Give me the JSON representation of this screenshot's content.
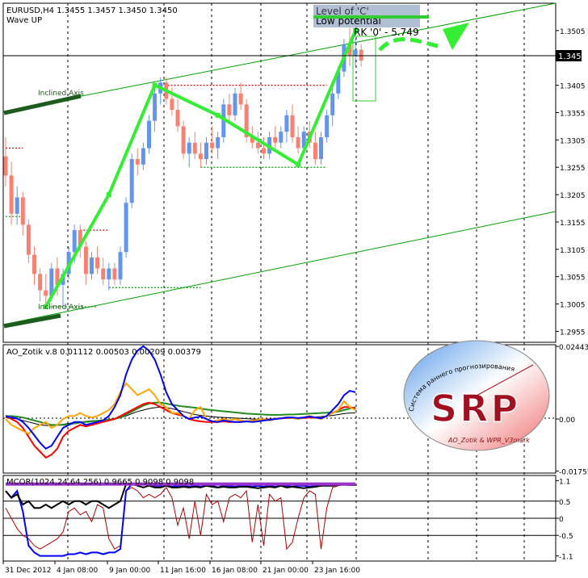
{
  "header": {
    "symbol_line": "EURUSD,H4  1.3455 1.3457 1.3450 1.3450",
    "wave_label": "Wave UP"
  },
  "annotations": {
    "level_c": "Level of 'C'",
    "low_potential": "Low potential",
    "rk_label": "RK '0' - ",
    "rk_value": "5.749",
    "inclined_axis_top": "Inclined Axis",
    "inclined_axis_bottom": "Inclined Axis"
  },
  "colors": {
    "bull": "#6495ED",
    "bear": "#FA8072",
    "wave": "#33EE33",
    "channel": "#00A000",
    "axis_bold": "#1E5B1E",
    "level_box": "#A8B8D0",
    "blue_line": "#0000FF",
    "orange_line": "#FFA500",
    "green_line": "#228B22",
    "red_line": "#FF0000",
    "black_line": "#000000",
    "purple_line": "#9933CC"
  },
  "price_panel": {
    "current_price": "1.3450",
    "ticks": [
      "1.3505",
      "1.3405",
      "1.3355",
      "1.3305",
      "1.3255",
      "1.3205",
      "1.3155",
      "1.3105",
      "1.3055",
      "1.3005",
      "1.2955"
    ]
  },
  "ao_panel": {
    "title": "AO_Zotik v.8 0.01112 0.00503 0.00209 0.00379",
    "ticks": [
      "0.02443",
      "0.00",
      "-0.01755"
    ]
  },
  "mcor_panel": {
    "title": "MCOR(1024,24,64,256) 0.9665 0.9098 0.9098",
    "ticks": [
      "1.1",
      "0.5",
      "0",
      "-0.5",
      "-1.1"
    ]
  },
  "time_axis": {
    "labels": [
      "31 Dec 2012",
      "4 Jan 08:00",
      "9 Jan 00:00",
      "11 Jan 16:00",
      "16 Jan 08:00",
      "21 Jan 00:00",
      "23 Jan 16:00"
    ]
  },
  "logo": {
    "letters": "SRP",
    "arc_text": "Система раннего прогнозирования",
    "caption": "AO_Zotik & WPR_V3mark"
  },
  "chart_data": [
    {
      "type": "candlestick",
      "symbol": "EURUSD",
      "timeframe": "H4",
      "ylim": [
        1.2935,
        1.3555
      ],
      "candles": [
        [
          1.3275,
          1.331,
          1.322,
          1.324
        ],
        [
          1.324,
          1.3265,
          1.315,
          1.317
        ],
        [
          1.317,
          1.322,
          1.315,
          1.32
        ],
        [
          1.32,
          1.321,
          1.313,
          1.315
        ],
        [
          1.315,
          1.316,
          1.308,
          1.3095
        ],
        [
          1.3095,
          1.311,
          1.304,
          1.306
        ],
        [
          1.306,
          1.307,
          1.301,
          1.303
        ],
        [
          1.303,
          1.306,
          1.3,
          1.302
        ],
        [
          1.302,
          1.308,
          1.301,
          1.307
        ],
        [
          1.307,
          1.309,
          1.302,
          1.304
        ],
        [
          1.304,
          1.307,
          1.3,
          1.306
        ],
        [
          1.306,
          1.311,
          1.305,
          1.31
        ],
        [
          1.31,
          1.315,
          1.308,
          1.314
        ],
        [
          1.314,
          1.315,
          1.309,
          1.311
        ],
        [
          1.311,
          1.312,
          1.304,
          1.306
        ],
        [
          1.306,
          1.31,
          1.305,
          1.309
        ],
        [
          1.309,
          1.311,
          1.306,
          1.307
        ],
        [
          1.307,
          1.309,
          1.304,
          1.305
        ],
        [
          1.305,
          1.308,
          1.303,
          1.307
        ],
        [
          1.307,
          1.308,
          1.304,
          1.305
        ],
        [
          1.305,
          1.311,
          1.304,
          1.31
        ],
        [
          1.31,
          1.32,
          1.309,
          1.319
        ],
        [
          1.319,
          1.328,
          1.318,
          1.327
        ],
        [
          1.327,
          1.329,
          1.324,
          1.326
        ],
        [
          1.326,
          1.33,
          1.325,
          1.329
        ],
        [
          1.329,
          1.335,
          1.328,
          1.334
        ],
        [
          1.334,
          1.34,
          1.332,
          1.339
        ],
        [
          1.339,
          1.342,
          1.337,
          1.341
        ],
        [
          1.341,
          1.342,
          1.337,
          1.338
        ],
        [
          1.338,
          1.34,
          1.335,
          1.336
        ],
        [
          1.336,
          1.338,
          1.332,
          1.333
        ],
        [
          1.333,
          1.334,
          1.327,
          1.328
        ],
        [
          1.328,
          1.331,
          1.3255,
          1.33
        ],
        [
          1.33,
          1.332,
          1.327,
          1.328
        ],
        [
          1.328,
          1.33,
          1.3255,
          1.327
        ],
        [
          1.327,
          1.331,
          1.326,
          1.33
        ],
        [
          1.33,
          1.333,
          1.328,
          1.329
        ],
        [
          1.329,
          1.332,
          1.327,
          1.331
        ],
        [
          1.331,
          1.338,
          1.33,
          1.337
        ],
        [
          1.337,
          1.339,
          1.334,
          1.335
        ],
        [
          1.335,
          1.34,
          1.334,
          1.339
        ],
        [
          1.339,
          1.341,
          1.336,
          1.337
        ],
        [
          1.337,
          1.338,
          1.33,
          1.331
        ],
        [
          1.331,
          1.333,
          1.329,
          1.33
        ],
        [
          1.33,
          1.332,
          1.328,
          1.329
        ],
        [
          1.329,
          1.331,
          1.327,
          1.328
        ],
        [
          1.328,
          1.332,
          1.327,
          1.331
        ],
        [
          1.331,
          1.333,
          1.329,
          1.33
        ],
        [
          1.33,
          1.333,
          1.329,
          1.332
        ],
        [
          1.332,
          1.336,
          1.33,
          1.335
        ],
        [
          1.335,
          1.337,
          1.33,
          1.331
        ],
        [
          1.331,
          1.333,
          1.328,
          1.329
        ],
        [
          1.329,
          1.333,
          1.328,
          1.332
        ],
        [
          1.332,
          1.334,
          1.329,
          1.33
        ],
        [
          1.33,
          1.332,
          1.326,
          1.327
        ],
        [
          1.327,
          1.332,
          1.326,
          1.331
        ],
        [
          1.331,
          1.336,
          1.33,
          1.335
        ],
        [
          1.335,
          1.34,
          1.333,
          1.339
        ],
        [
          1.339,
          1.344,
          1.338,
          1.343
        ],
        [
          1.343,
          1.349,
          1.342,
          1.348
        ],
        [
          1.348,
          1.351,
          1.344,
          1.346
        ],
        [
          1.346,
          1.349,
          1.344,
          1.347
        ],
        [
          1.347,
          1.348,
          1.344,
          1.345
        ]
      ],
      "wave_path": [
        [
          7,
          1.3
        ],
        [
          18,
          1.3205
        ],
        [
          26,
          1.3405
        ],
        [
          37,
          1.335
        ],
        [
          51,
          1.326
        ],
        [
          61,
          1.3505
        ]
      ],
      "support_resistance": [
        {
          "price": 1.3405,
          "color": "red",
          "from": 26,
          "to": 56
        },
        {
          "price": 1.3255,
          "color": "green",
          "from": 34,
          "to": 56
        },
        {
          "price": 1.329,
          "color": "red",
          "from": 0,
          "to": 3
        },
        {
          "price": 1.314,
          "color": "red",
          "from": 13,
          "to": 18
        },
        {
          "price": 1.3165,
          "color": "green",
          "from": 0,
          "to": 3
        },
        {
          "price": 1.3035,
          "color": "green",
          "from": 18,
          "to": 34
        },
        {
          "price": 1.3,
          "color": "green",
          "from": 7,
          "to": 16
        }
      ]
    },
    {
      "type": "line",
      "name": "AO_Zotik v.8",
      "ylim": [
        -0.0182,
        0.025
      ],
      "series": [
        {
          "name": "blue",
          "values": [
            0.001,
            0.0005,
            0.0002,
            -0.001,
            -0.003,
            -0.0055,
            -0.008,
            -0.01,
            -0.009,
            -0.006,
            -0.003,
            -0.002,
            -0.001,
            -0.001,
            -0.002,
            -0.0015,
            -0.001,
            -0.0005,
            0.001,
            0.004,
            0.008,
            0.015,
            0.02,
            0.023,
            0.0245,
            0.023,
            0.02,
            0.015,
            0.009,
            0.005,
            0.003,
            0.001,
            0.0,
            0.0005,
            0.0008,
            0.0,
            -0.0008,
            -0.001,
            -0.0005,
            -0.0008,
            -0.001,
            -0.001,
            -0.0008,
            -0.001,
            -0.0008,
            -0.0005,
            -0.0003,
            0.0,
            0.0002,
            0.0005,
            0.0005,
            0.0003,
            0.0005,
            0.0008,
            0.0005,
            0.0002,
            0.001,
            0.003,
            0.005,
            0.008,
            0.0095,
            0.009
          ]
        },
        {
          "name": "orange",
          "values": [
            0.0,
            -0.002,
            -0.003,
            -0.004,
            -0.005,
            -0.003,
            -0.002,
            -0.001,
            -0.003,
            -0.002,
            0.0,
            0.001,
            0.001,
            0.002,
            0.001,
            0.0005,
            0.001,
            0.002,
            0.003,
            0.005,
            0.009,
            0.012,
            0.01,
            0.008,
            0.009,
            0.01,
            0.008,
            0.005,
            0.004,
            0.002,
            0.002,
            0.001,
            0.0,
            0.003,
            0.004,
            0.0,
            -0.0008,
            -0.0005,
            0.0,
            -0.0005,
            0.0,
            -0.0005,
            -0.0008,
            -0.0005,
            -0.0003,
            0.0,
            -0.0005,
            0.0,
            0.0003,
            0.0005,
            0.0003,
            0.0,
            0.0005,
            0.001,
            0.0005,
            0.0,
            0.001,
            0.002,
            0.003,
            0.006,
            0.004,
            0.003
          ]
        },
        {
          "name": "red",
          "values": [
            0.001,
            0.0,
            -0.001,
            -0.003,
            -0.006,
            -0.009,
            -0.011,
            -0.013,
            -0.012,
            -0.01,
            -0.006,
            -0.004,
            -0.003,
            -0.002,
            -0.0025,
            -0.002,
            -0.0015,
            -0.001,
            -0.0005,
            0.0,
            0.001,
            0.002,
            0.003,
            0.004,
            0.005,
            0.0055,
            0.005,
            0.004,
            0.003,
            0.002,
            0.0015,
            0.001,
            0.0,
            -0.0005,
            -0.0008,
            -0.001,
            -0.001,
            -0.001,
            -0.0008,
            -0.001,
            -0.001,
            -0.001,
            -0.0008,
            -0.0006,
            -0.0005,
            -0.0003,
            -0.0002,
            0.0,
            0.0002,
            0.0003,
            0.0003,
            0.0002,
            0.0003,
            0.0005,
            0.0004,
            0.0003,
            0.001,
            0.002,
            0.003,
            0.004,
            0.004,
            0.0035
          ]
        },
        {
          "name": "green",
          "values": [
            0.001,
            0.001,
            0.0008,
            0.0005,
            0.0,
            -0.0005,
            -0.001,
            -0.0015,
            -0.002,
            -0.002,
            -0.002,
            -0.0018,
            -0.0015,
            -0.0012,
            -0.001,
            -0.0008,
            -0.0006,
            -0.0004,
            -0.0002,
            0.0,
            0.0005,
            0.0015,
            0.0025,
            0.0035,
            0.0045,
            0.0052,
            0.0055,
            0.0055,
            0.0052,
            0.0048,
            0.0045,
            0.0042,
            0.004,
            0.0038,
            0.0035,
            0.0032,
            0.003,
            0.0028,
            0.0026,
            0.0024,
            0.0022,
            0.002,
            0.0018,
            0.0017,
            0.0016,
            0.0015,
            0.0014,
            0.0014,
            0.0014,
            0.0015,
            0.0015,
            0.0016,
            0.0017,
            0.0018,
            0.0019,
            0.002,
            0.0021,
            0.0022,
            0.0025,
            0.003,
            0.0035,
            0.004
          ]
        },
        {
          "name": "black",
          "values": [
            0.0005,
            0.0003,
            0.0,
            -0.0005,
            -0.001,
            -0.0015,
            -0.002,
            -0.0022,
            -0.0022,
            -0.002,
            -0.0018,
            -0.0015,
            -0.0012,
            -0.001,
            -0.0008,
            -0.0006,
            -0.0005,
            -0.0003,
            -0.0002,
            0.0,
            0.0005,
            0.001,
            0.0018,
            0.0025,
            0.003,
            0.0035,
            0.0038,
            0.004,
            0.0038,
            0.0035,
            0.003,
            0.0025,
            0.002,
            0.0015,
            0.0012,
            0.001,
            0.0008,
            0.0006,
            0.0005,
            0.0004,
            0.0003,
            0.0002,
            0.0001,
            0.0,
            -0.0001,
            -0.0001,
            0.0,
            0.0,
            0.0001,
            0.0002,
            0.0003,
            0.0004,
            0.0005,
            0.0006,
            0.0007,
            0.0008,
            0.001,
            0.0012,
            0.0015,
            0.0018,
            0.002,
            0.002
          ]
        }
      ]
    },
    {
      "type": "line",
      "name": "MCOR(1024,24,64,256)",
      "ylim": [
        -1.25,
        1.25
      ],
      "series": [
        {
          "name": "purple",
          "values": [
            1.0,
            1.0,
            1.0,
            1.0,
            1.0,
            1.0,
            1.0,
            1.0,
            1.0,
            1.0,
            1.0,
            1.0,
            1.0,
            1.0,
            1.0,
            1.0,
            1.0,
            1.0,
            1.0,
            1.0,
            1.0,
            1.0,
            1.0,
            1.0,
            1.0,
            1.0,
            1.0,
            1.0,
            1.0,
            1.0,
            1.0,
            1.0,
            1.0,
            1.0,
            1.0,
            1.0,
            1.0,
            1.0,
            1.0,
            1.0,
            1.0,
            1.0,
            1.0,
            1.0,
            1.0,
            1.0,
            1.0,
            1.0,
            1.0,
            1.0,
            1.0,
            1.0,
            1.0,
            1.0,
            1.0,
            1.0,
            1.0,
            1.0,
            1.0,
            1.0,
            1.0,
            1.0
          ]
        },
        {
          "name": "black",
          "values": [
            0.8,
            0.6,
            0.7,
            0.4,
            0.5,
            0.3,
            0.3,
            0.4,
            0.3,
            0.4,
            0.5,
            0.4,
            0.5,
            0.5,
            0.4,
            0.5,
            0.5,
            0.4,
            0.3,
            0.4,
            0.5,
            1.0,
            1.0,
            0.95,
            0.9,
            0.95,
            0.9,
            0.9,
            0.95,
            0.9,
            0.9,
            0.92,
            0.9,
            0.92,
            0.9,
            0.95,
            0.92,
            0.9,
            0.92,
            0.9,
            0.9,
            0.92,
            0.92,
            0.9,
            0.88,
            0.9,
            0.92,
            0.9,
            0.95,
            0.9,
            0.92,
            0.9,
            0.88,
            0.9,
            0.92,
            0.95,
            0.95,
            0.95,
            0.97,
            0.98,
            0.97,
            0.97
          ]
        },
        {
          "name": "blue",
          "values": [
            0.8,
            0.6,
            0.8,
            0.2,
            -0.8,
            -1.0,
            -1.1,
            -1.1,
            -1.1,
            -1.1,
            -1.1,
            -1.05,
            -1.05,
            -1.0,
            -1.05,
            -1.0,
            -1.0,
            -1.05,
            -1.0,
            -1.0,
            -0.9,
            0.8,
            1.0,
            1.0,
            1.0,
            1.0,
            0.95,
            0.95,
            0.95,
            0.92,
            0.95,
            0.95,
            0.92,
            0.95,
            0.92,
            0.95,
            0.95,
            0.9,
            0.95,
            0.95,
            0.92,
            0.95,
            0.95,
            0.92,
            0.95,
            0.92,
            0.95,
            0.92,
            0.95,
            0.95,
            0.92,
            0.95,
            0.95,
            0.92,
            0.95,
            0.95,
            0.97,
            1.0,
            1.0,
            1.0,
            1.0,
            1.0
          ]
        },
        {
          "name": "red",
          "values": [
            0.3,
            0.0,
            -0.3,
            -0.5,
            -0.6,
            -0.8,
            -0.9,
            -0.8,
            -0.7,
            -0.6,
            -0.4,
            0.2,
            0.3,
            0.1,
            0.2,
            -0.1,
            0.4,
            0.3,
            -0.6,
            -0.9,
            -0.8,
            0.8,
            0.9,
            0.8,
            0.6,
            0.7,
            0.6,
            0.7,
            0.9,
            0.6,
            -0.2,
            0.3,
            -0.6,
            0.5,
            -0.5,
            0.7,
            0.4,
            0.5,
            -0.1,
            0.6,
            0.7,
            0.6,
            0.8,
            -0.7,
            0.4,
            -0.8,
            0.7,
            0.5,
            0.6,
            -0.9,
            -0.7,
            0.0,
            0.6,
            0.8,
            0.7,
            -0.9,
            0.3,
            0.9,
            0.95,
            1.0,
            1.0,
            1.0
          ]
        }
      ]
    }
  ]
}
